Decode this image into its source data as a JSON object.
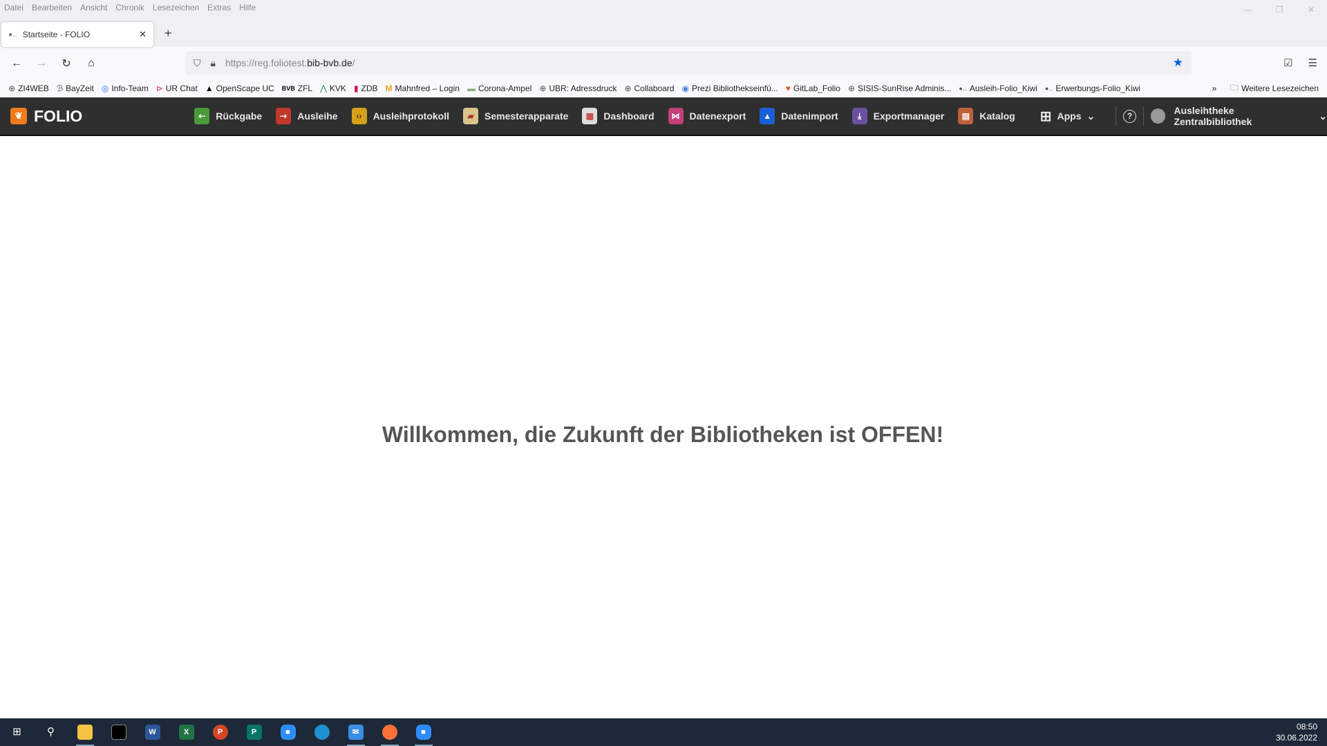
{
  "browser": {
    "menu": [
      "Datei",
      "Bearbeiten",
      "Ansicht",
      "Chronik",
      "Lesezeichen",
      "Extras",
      "Hilfe"
    ],
    "tab_title": "Startseite - FOLIO",
    "url_prefix": "https://reg.foliotest.",
    "url_domain": "bib-bvb.de",
    "url_suffix": "/",
    "bookmarks": [
      "ZI4WEB",
      "BayZeit",
      "Info-Team",
      "UR Chat",
      "OpenScape UC",
      "ZFL",
      "KVK",
      "ZDB",
      "Mahnfred – Login",
      "Corona-Ampel",
      "UBR: Adressdruck",
      "Collaboard",
      "Prezi Bibliothekseinfü...",
      "GitLab_Folio",
      "SISIS-SunRise Adminis...",
      "Ausleih-Folio_Kiwi",
      "Erwerbungs-Folio_Kiwi"
    ],
    "more_bookmarks": "Weitere Lesezeichen"
  },
  "folio": {
    "logo": "FOLIO",
    "apps": [
      {
        "label": "Rückgabe",
        "color": "#4a9a3c",
        "icon": "return-icon"
      },
      {
        "label": "Ausleihe",
        "color": "#c0392b",
        "icon": "checkout-icon"
      },
      {
        "label": "Ausleihprotokoll",
        "color": "#d4a017",
        "icon": "circ-log-icon"
      },
      {
        "label": "Semesterapparate",
        "color": "#d9c48a",
        "icon": "book-icon"
      },
      {
        "label": "Dashboard",
        "color": "#dddddd",
        "icon": "dashboard-icon"
      },
      {
        "label": "Datenexport",
        "color": "#c2407a",
        "icon": "export-icon"
      },
      {
        "label": "Datenimport",
        "color": "#1a5fd6",
        "icon": "import-icon"
      },
      {
        "label": "Exportmanager",
        "color": "#6b4fa0",
        "icon": "download-icon"
      },
      {
        "label": "Katalog",
        "color": "#c0603a",
        "icon": "catalog-icon"
      }
    ],
    "apps_menu": "Apps",
    "user": "Ausleihtheke Zentralbibliothek"
  },
  "main": {
    "welcome": "Willkommen, die Zukunft der Bibliotheken ist OFFEN!"
  },
  "taskbar": {
    "time": "08:50",
    "date": "30.06.2022"
  }
}
